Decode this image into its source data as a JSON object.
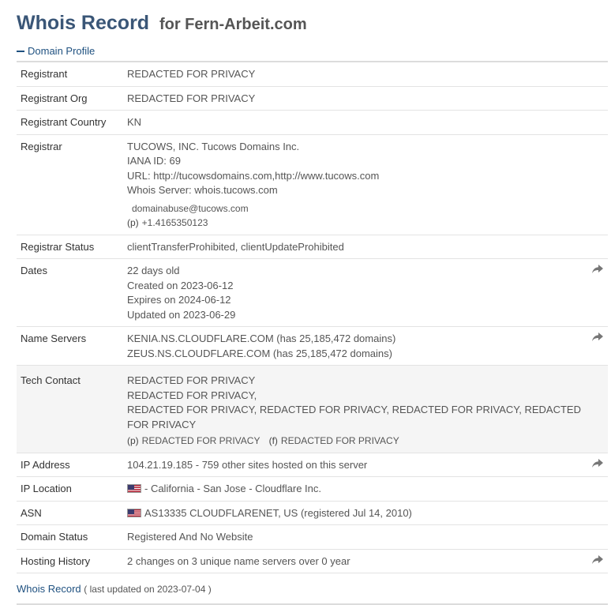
{
  "page": {
    "title_main": "Whois Record",
    "title_sub": "for Fern-Arbeit.com"
  },
  "section": {
    "label": "Domain Profile"
  },
  "rows": {
    "registrant": {
      "label": "Registrant",
      "value": "REDACTED FOR PRIVACY"
    },
    "registrant_org": {
      "label": "Registrant Org",
      "value": "REDACTED FOR PRIVACY"
    },
    "registrant_country": {
      "label": "Registrant Country",
      "value": "KN"
    },
    "registrar": {
      "label": "Registrar",
      "name": "TUCOWS, INC. Tucows Domains Inc.",
      "iana": "IANA ID: 69",
      "url": "URL: http://tucowsdomains.com,http://www.tucows.com",
      "whois_server": "Whois Server: whois.tucows.com",
      "email": "domainabuse@tucows.com",
      "phone_tag": "(p)",
      "phone": "+1.4165350123"
    },
    "registrar_status": {
      "label": "Registrar Status",
      "value": "clientTransferProhibited, clientUpdateProhibited"
    },
    "dates": {
      "label": "Dates",
      "age": "22 days old",
      "created": "Created on 2023-06-12",
      "expires": "Expires on 2024-06-12",
      "updated": "Updated on 2023-06-29"
    },
    "name_servers": {
      "label": "Name Servers",
      "ns1": "KENIA.NS.CLOUDFLARE.COM (has 25,185,472 domains)",
      "ns2": "ZEUS.NS.CLOUDFLARE.COM (has 25,185,472 domains)"
    },
    "tech_contact": {
      "label": "Tech Contact",
      "line1": "REDACTED FOR PRIVACY",
      "line2": "REDACTED FOR PRIVACY,",
      "line3": "REDACTED FOR PRIVACY, REDACTED FOR PRIVACY, REDACTED FOR PRIVACY, REDACTED FOR PRIVACY",
      "phone_tag": "(p)",
      "phone": "REDACTED FOR PRIVACY",
      "fax_tag": "(f)",
      "fax": "REDACTED FOR PRIVACY"
    },
    "ip_address": {
      "label": "IP Address",
      "value": "104.21.19.185 - 759 other sites hosted on this server"
    },
    "ip_location": {
      "label": "IP Location",
      "value": "- California - San Jose - Cloudflare Inc."
    },
    "asn": {
      "label": "ASN",
      "value": "AS13335 CLOUDFLARENET, US (registered Jul 14, 2010)"
    },
    "domain_status": {
      "label": "Domain Status",
      "value": "Registered And No Website"
    },
    "hosting_history": {
      "label": "Hosting History",
      "value": "2 changes on 3 unique name servers over 0 year"
    }
  },
  "footer": {
    "title": "Whois Record",
    "updated": "( last updated on 2023-07-04 )"
  },
  "icons": {
    "share": "share-arrow-icon",
    "flag": "us-flag-icon",
    "collapse": "minus-icon"
  },
  "colors": {
    "title": "#3a5677",
    "link": "#1f5180",
    "shaded_row": "#f5f5f5"
  }
}
